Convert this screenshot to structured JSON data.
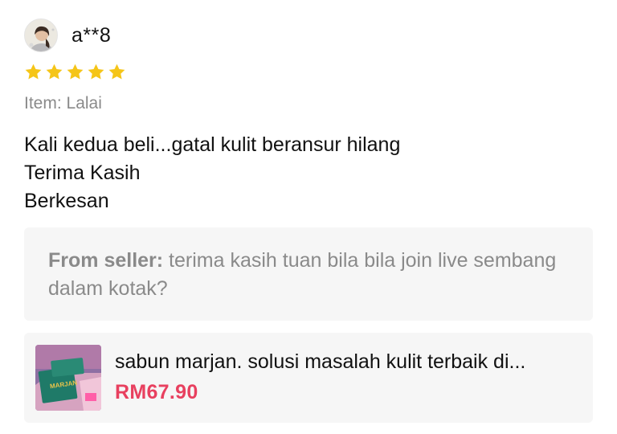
{
  "review": {
    "username": "a**8",
    "rating": 5,
    "rating_max": 5,
    "star_color": "#f5c518",
    "item_label": "Item: Lalai",
    "content_lines": [
      "Kali kedua beli...gatal kulit beransur hilang",
      "Terima Kasih",
      "Berkesan"
    ]
  },
  "seller_reply": {
    "label": "From seller:",
    "text": " terima kasih tuan bila bila join live sembang dalam kotak?"
  },
  "product": {
    "title": "sabun marjan. solusi masalah kulit terbaik di...",
    "price": "RM67.90",
    "price_color": "#e8405f",
    "thumbnail_brand": "MARJAN"
  }
}
